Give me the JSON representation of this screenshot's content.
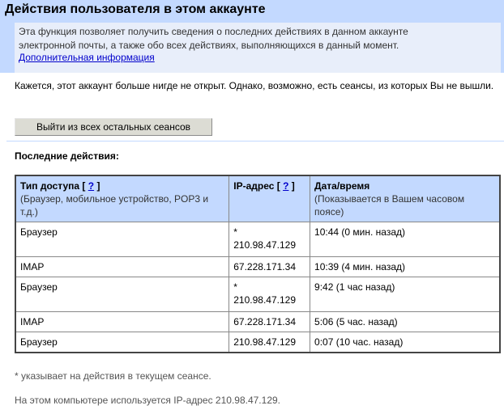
{
  "header": {
    "title": "Действия пользователя в этом аккаунте",
    "intro_line1": "Эта функция позволяет получить сведения о последних действиях в данном аккаунте",
    "intro_line2": "электронной почты, а также обо всех действиях, выполняющихся в данный момент.",
    "more_info_link": "Дополнительная информация"
  },
  "notice": "Кажется, этот аккаунт больше нигде не открыт. Однако, возможно, есть сеансы, из которых Вы не вышли.",
  "signout_button": "Выйти из всех остальных сеансов",
  "recent_label": "Последние действия:",
  "table": {
    "headers": [
      {
        "title": "Тип доступа",
        "help": "?",
        "subtitle": "(Браузер, мобильное устройство, POP3 и т.д.)"
      },
      {
        "title": "IP-адрес",
        "help": "?",
        "subtitle": ""
      },
      {
        "title": "Дата/время",
        "help": "",
        "subtitle": "(Показывается в Вашем часовом поясе)"
      }
    ],
    "rows": [
      {
        "type": "Браузер",
        "ip_marker": "*",
        "ip": "210.98.47.129",
        "time": "10:44 (0 мин. назад)"
      },
      {
        "type": "IMAP",
        "ip_marker": "",
        "ip": "67.228.171.34",
        "time": "10:39 (4 мин. назад)"
      },
      {
        "type": "Браузер",
        "ip_marker": "*",
        "ip": "210.98.47.129",
        "time": "9:42 (1 час назад)"
      },
      {
        "type": "IMAP",
        "ip_marker": "",
        "ip": "67.228.171.34",
        "time": "5:06 (5 час. назад)"
      },
      {
        "type": "Браузер",
        "ip_marker": "",
        "ip": "210.98.47.129",
        "time": "0:07 (10 час. назад)"
      }
    ]
  },
  "footnotes": {
    "current_session": "* указывает на действия в текущем сеансе.",
    "this_computer_ip": "На этом компьютере используется IP-адрес 210.98.47.129."
  },
  "colors": {
    "header_bg": "#c3d9ff",
    "intro_bg": "#e8eefa",
    "link": "#0000cc"
  }
}
